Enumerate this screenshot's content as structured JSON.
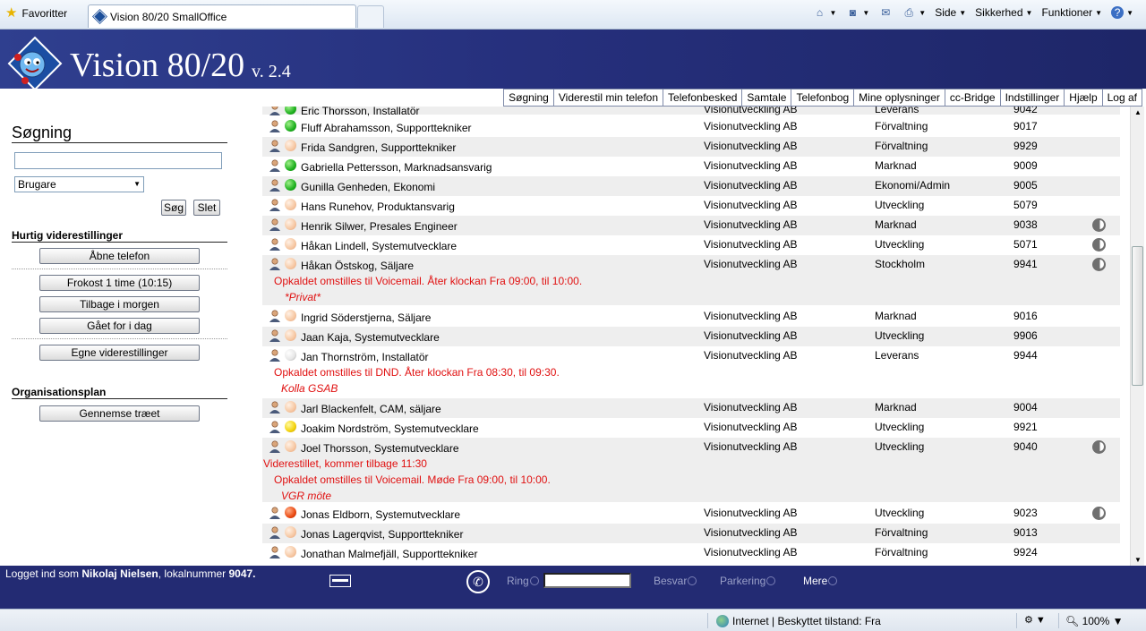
{
  "browser": {
    "favorites": "Favoritter",
    "tab_title": "Vision 80/20 SmallOffice",
    "tools": {
      "page": "Side",
      "security": "Sikkerhed",
      "functions": "Funktioner"
    },
    "statusbar": {
      "zone": "Internet | Beskyttet tilstand: Fra",
      "zoom": "100%"
    }
  },
  "app": {
    "title": "Vision 80/20",
    "version": "v. 2.4"
  },
  "nav": [
    "Søgning",
    "Viderestil min telefon",
    "Telefonbesked",
    "Samtale",
    "Telefonbog",
    "Mine oplysninger",
    "cc-Bridge",
    "Indstillinger",
    "Hjælp",
    "Log af"
  ],
  "left": {
    "search_title": "Søgning",
    "search_value": "",
    "select_value": "Brugare",
    "search_btn": "Søg",
    "clear_btn": "Slet",
    "quick_title": "Hurtig viderestillinger",
    "quick_buttons": [
      "Åbne telefon",
      "Frokost 1 time (10:15)",
      "Tilbage i morgen",
      "Gået for i dag",
      "Egne viderestillinger"
    ],
    "org_title": "Organisationsplan",
    "org_btn": "Gennemse træet"
  },
  "contacts": [
    {
      "name": "Eric Thorsson, Installatör",
      "company": "Visionutveckling AB",
      "dept": "Leverans",
      "ext": "9042",
      "status": "green",
      "moon": false
    },
    {
      "name": "Fluff Abrahamsson, Supporttekniker",
      "company": "Visionutveckling AB",
      "dept": "Förvaltning",
      "ext": "9017",
      "status": "green",
      "moon": false
    },
    {
      "name": "Frida Sandgren, Supporttekniker",
      "company": "Visionutveckling AB",
      "dept": "Förvaltning",
      "ext": "9929",
      "status": "peach",
      "moon": false
    },
    {
      "name": "Gabriella Pettersson, Marknadsansvarig",
      "company": "Visionutveckling AB",
      "dept": "Marknad",
      "ext": "9009",
      "status": "green",
      "moon": false
    },
    {
      "name": "Gunilla Genheden, Ekonomi",
      "company": "Visionutveckling AB",
      "dept": "Ekonomi/Admin",
      "ext": "9005",
      "status": "green",
      "moon": false
    },
    {
      "name": "Hans Runehov, Produktansvarig",
      "company": "Visionutveckling AB",
      "dept": "Utveckling",
      "ext": "5079",
      "status": "peach",
      "moon": false
    },
    {
      "name": "Henrik Silwer, Presales Engineer",
      "company": "Visionutveckling AB",
      "dept": "Marknad",
      "ext": "9038",
      "status": "peach",
      "moon": true
    },
    {
      "name": "Håkan Lindell, Systemutvecklare",
      "company": "Visionutveckling AB",
      "dept": "Utveckling",
      "ext": "5071",
      "status": "peach",
      "moon": true
    },
    {
      "name": "Håkan Östskog, Säljare",
      "company": "Visionutveckling AB",
      "dept": "Stockholm",
      "ext": "9941",
      "status": "peach",
      "moon": true
    },
    {
      "name": "Ingrid Söderstjerna, Säljare",
      "company": "Visionutveckling AB",
      "dept": "Marknad",
      "ext": "9016",
      "status": "peach",
      "moon": false
    },
    {
      "name": "Jaan Kaja, Systemutvecklare",
      "company": "Visionutveckling AB",
      "dept": "Utveckling",
      "ext": "9906",
      "status": "peach",
      "moon": false
    },
    {
      "name": "Jan Thornström, Installatör",
      "company": "Visionutveckling AB",
      "dept": "Leverans",
      "ext": "9944",
      "status": "white",
      "moon": false
    },
    {
      "name": "Jarl Blackenfelt, CAM, säljare",
      "company": "Visionutveckling AB",
      "dept": "Marknad",
      "ext": "9004",
      "status": "peach",
      "moon": false
    },
    {
      "name": "Joakim Nordström, Systemutvecklare",
      "company": "Visionutveckling AB",
      "dept": "Utveckling",
      "ext": "9921",
      "status": "yellow",
      "moon": false
    },
    {
      "name": "Joel Thorsson, Systemutvecklare",
      "company": "Visionutveckling AB",
      "dept": "Utveckling",
      "ext": "9040",
      "status": "peach",
      "moon": true
    },
    {
      "name": "Jonas Eldborn, Systemutvecklare",
      "company": "Visionutveckling AB",
      "dept": "Utveckling",
      "ext": "9023",
      "status": "red",
      "moon": true
    },
    {
      "name": "Jonas Lagerqvist, Supporttekniker",
      "company": "Visionutveckling AB",
      "dept": "Förvaltning",
      "ext": "9013",
      "status": "peach",
      "moon": false
    },
    {
      "name": "Jonathan Malmefjäll, Supporttekniker",
      "company": "Visionutveckling AB",
      "dept": "Förvaltning",
      "ext": "9924",
      "status": "peach",
      "moon": false
    }
  ],
  "messages": {
    "hakan_ostskog": [
      "Opkaldet omstilles til Voicemail. Åter klockan Fra 09:00, til 10:00.",
      "*Privat*"
    ],
    "jan_thornstrom": [
      "Opkaldet omstilles til DND. Åter klockan Fra 08:30, til 09:30.",
      "Kolla GSAB"
    ],
    "joel_thorsson": [
      "Viderestillet, kommer tilbage 11:30",
      "Opkaldet omstilles til Voicemail. Møde Fra 09:00, til 10:00.",
      "VGR möte"
    ]
  },
  "status": {
    "login_prefix": "Logget ind som ",
    "user": "Nikolaj Nielsen",
    "login_mid": ", lokalnummer ",
    "ext": "9047",
    "login_end": ".",
    "ring": "Ring",
    "answer": "Besvar",
    "park": "Parkering",
    "more": "Mere"
  },
  "colors": {
    "header": "#26307d",
    "status_bar": "#232b73",
    "message_red": "#e01010",
    "alt_row": "#eeeeee"
  }
}
